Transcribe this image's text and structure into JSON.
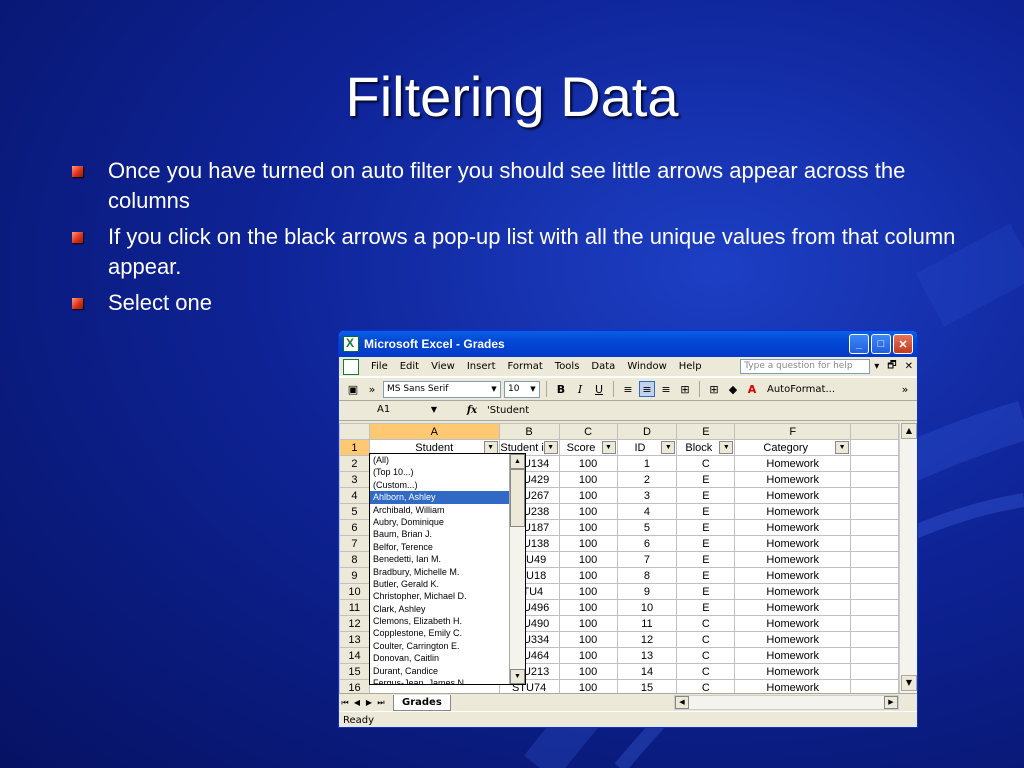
{
  "slide": {
    "title": "Filtering Data",
    "bullets": [
      "Once you have turned on auto filter you should see little arrows appear across the columns",
      "If you click on the black arrows a pop-up list with all the unique values from that column appear.",
      "Select one"
    ]
  },
  "excel": {
    "window_title": "Microsoft Excel - Grades",
    "menu": [
      "File",
      "Edit",
      "View",
      "Insert",
      "Format",
      "Tools",
      "Data",
      "Window",
      "Help"
    ],
    "help_placeholder": "Type a question for help",
    "font_name": "MS Sans Serif",
    "font_size": "10",
    "autoformat": "AutoFormat...",
    "name_box": "A1",
    "formula": "'Student",
    "columns": [
      "A",
      "B",
      "C",
      "D",
      "E",
      "F"
    ],
    "headers": [
      "Student",
      "Student i",
      "Score",
      "ID",
      "Block",
      "Category"
    ],
    "rows": [
      {
        "n": "2",
        "b": "STU134",
        "c": "100",
        "d": "1",
        "e": "C",
        "f": "Homework"
      },
      {
        "n": "3",
        "b": "STU429",
        "c": "100",
        "d": "2",
        "e": "E",
        "f": "Homework"
      },
      {
        "n": "4",
        "b": "STU267",
        "c": "100",
        "d": "3",
        "e": "E",
        "f": "Homework"
      },
      {
        "n": "5",
        "b": "STU238",
        "c": "100",
        "d": "4",
        "e": "E",
        "f": "Homework"
      },
      {
        "n": "6",
        "b": "STU187",
        "c": "100",
        "d": "5",
        "e": "E",
        "f": "Homework"
      },
      {
        "n": "7",
        "b": "STU138",
        "c": "100",
        "d": "6",
        "e": "E",
        "f": "Homework"
      },
      {
        "n": "8",
        "b": "STU49",
        "c": "100",
        "d": "7",
        "e": "E",
        "f": "Homework"
      },
      {
        "n": "9",
        "b": "STU18",
        "c": "100",
        "d": "8",
        "e": "E",
        "f": "Homework"
      },
      {
        "n": "10",
        "b": "STU4",
        "c": "100",
        "d": "9",
        "e": "E",
        "f": "Homework"
      },
      {
        "n": "11",
        "b": "STU496",
        "c": "100",
        "d": "10",
        "e": "E",
        "f": "Homework"
      },
      {
        "n": "12",
        "b": "STU490",
        "c": "100",
        "d": "11",
        "e": "C",
        "f": "Homework"
      },
      {
        "n": "13",
        "b": "STU334",
        "c": "100",
        "d": "12",
        "e": "C",
        "f": "Homework"
      },
      {
        "n": "14",
        "b": "STU464",
        "c": "100",
        "d": "13",
        "e": "C",
        "f": "Homework"
      },
      {
        "n": "15",
        "b": "STU213",
        "c": "100",
        "d": "14",
        "e": "C",
        "f": "Homework"
      },
      {
        "n": "16",
        "b": "STU74",
        "c": "100",
        "d": "15",
        "e": "C",
        "f": "Homework"
      }
    ],
    "filter_list": [
      "(All)",
      "(Top 10...)",
      "(Custom...)",
      "Ahlborn, Ashley",
      "Archibald, William",
      "Aubry, Dominique",
      "Baum, Brian J.",
      "Belfor, Terence",
      "Benedetti, Ian M.",
      "Bradbury, Michelle M.",
      "Butler, Gerald K.",
      "Christopher, Michael D.",
      "Clark, Ashley",
      "Clemons, Elizabeth H.",
      "Copplestone, Emily C.",
      "Coulter, Carrington E.",
      "Donovan, Caitlin",
      "Durant, Candice",
      "Fergus-Jean, James N."
    ],
    "filter_selected": "Ahlborn, Ashley",
    "sheet_tab": "Grades",
    "status": "Ready"
  }
}
